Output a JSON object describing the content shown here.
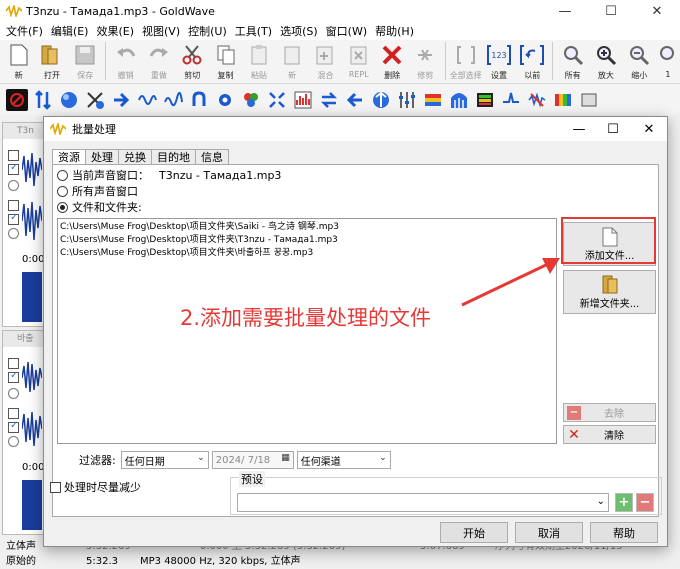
{
  "main_window": {
    "title": "T3nzu - Тамада1.mp3 - GoldWave",
    "minimize": "—",
    "maximize": "☐",
    "close": "✕"
  },
  "menu": [
    "文件(F)",
    "编辑(E)",
    "效果(E)",
    "视图(V)",
    "控制(U)",
    "工具(T)",
    "选项(S)",
    "窗口(W)",
    "帮助(H)"
  ],
  "toolbar": {
    "new": "新",
    "open": "打开",
    "save": "保存",
    "undo": "撤销",
    "redo": "重做",
    "cut": "剪切",
    "copy": "复制",
    "paste": "粘贴",
    "new2": "新",
    "mix": "混合",
    "repl": "REPL",
    "delete": "删除",
    "trim": "修剪",
    "select_all": "全部选择",
    "set": "设置",
    "previous": "以前",
    "all": "所有",
    "zoom_in": "放大",
    "zoom_out": "缩小",
    "one": "1"
  },
  "background": {
    "win1_title": "T3n",
    "win2_title": "바출",
    "time": "0:00"
  },
  "status": {
    "row1": [
      "立体声",
      "5:32.269",
      "0.000 至 5:32.269 (5:32.269)",
      "5:07.669",
      "序列号有效期至2026/11/15"
    ],
    "row2": [
      "原始的",
      "5:32.3",
      "MP3 48000 Hz, 320 kbps, 立体声"
    ]
  },
  "dialog": {
    "title": "批量处理",
    "minimize": "—",
    "maximize": "☐",
    "close": "✕",
    "tabs": [
      "资源",
      "处理",
      "兑换",
      "目的地",
      "信息"
    ],
    "radio_current": "当前声音窗口：",
    "radio_current_value": "T3nzu - Тамада1.mp3",
    "radio_all": "所有声音窗口",
    "radio_files": "文件和文件夹:",
    "files": [
      "C:\\Users\\Muse Frog\\Desktop\\项目文件夹\\Saiki - 鸟之诗 钢琴.mp3",
      "C:\\Users\\Muse Frog\\Desktop\\项目文件夹\\T3nzu - Тамада1.mp3",
      "C:\\Users\\Muse Frog\\Desktop\\项目文件夹\\바출하프 꿍꿍.mp3"
    ],
    "add_files": "添加文件...",
    "add_folder": "新增文件夹...",
    "remove": "去除",
    "clear": "清除",
    "filter_label": "过滤器:",
    "filter_date": "任何日期",
    "filter_date_value": "2024/ 7/18",
    "filter_channel": "任何渠道",
    "minimize_checkbox": "处理时尽量减少",
    "preset_label": "预设",
    "preset_value": "",
    "start": "开始",
    "cancel": "取消",
    "help": "帮助"
  },
  "annotation": "2.添加需要批量处理的文件",
  "colors": {
    "annotation_red": "#e53935",
    "highlight_red": "#e53935",
    "wave_blue": "#1a3c9c"
  }
}
